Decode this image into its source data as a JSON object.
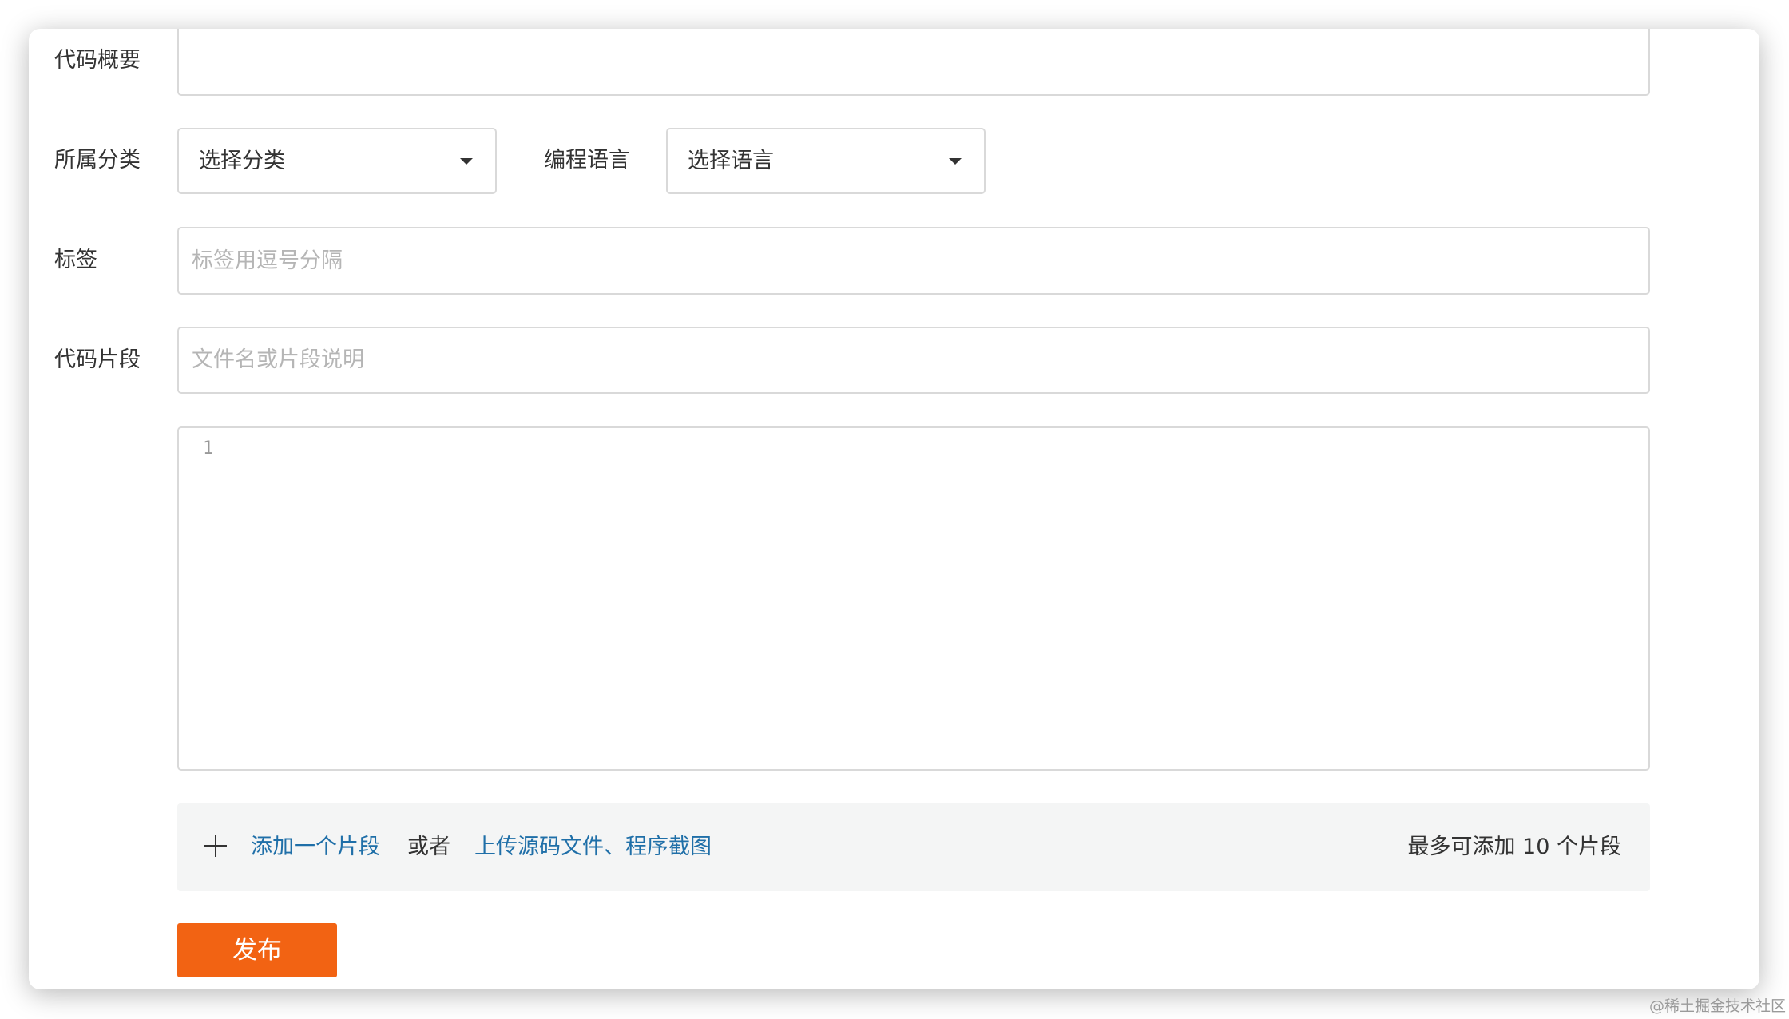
{
  "form": {
    "summary_label": "代码概要",
    "category_label": "所属分类",
    "category_value": "选择分类",
    "language_label": "编程语言",
    "language_value": "选择语言",
    "tags_label": "标签",
    "tags_placeholder": "标签用逗号分隔",
    "snippet_label": "代码片段",
    "snippet_placeholder": "文件名或片段说明",
    "editor_line_number": "1"
  },
  "add_bar": {
    "add_link": "添加一个片段",
    "or_text": "或者",
    "upload_link": "上传源码文件、程序截图",
    "limit_text": "最多可添加 10 个片段"
  },
  "actions": {
    "publish_label": "发布"
  },
  "watermark": "@稀土掘金技术社区",
  "colors": {
    "accent": "#f26313",
    "link": "#1f6fa8",
    "border": "#d9d9d9",
    "panel_bg": "#f4f5f5"
  }
}
